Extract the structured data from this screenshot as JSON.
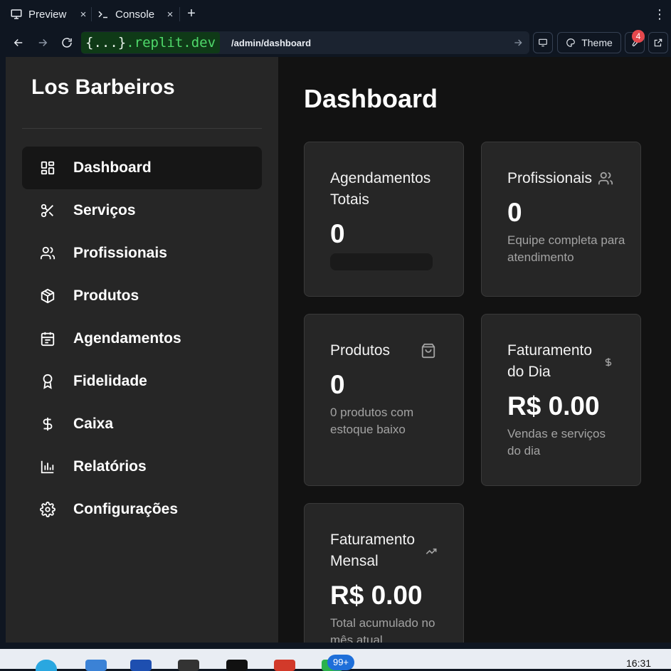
{
  "browser": {
    "tabs": [
      {
        "label": "Preview",
        "icon": "monitor-icon",
        "active": true
      },
      {
        "label": "Console",
        "icon": "terminal-icon",
        "active": false
      }
    ],
    "url_host_prefix": "{...}",
    "url_host": ".replit.dev",
    "url_path": "/admin/dashboard",
    "theme_label": "Theme",
    "extensions_badge": "4"
  },
  "sidebar": {
    "brand": "Los Barbeiros",
    "items": [
      {
        "label": "Dashboard",
        "icon": "grid-icon",
        "active": true
      },
      {
        "label": "Serviços",
        "icon": "scissors-icon"
      },
      {
        "label": "Profissionais",
        "icon": "users-icon"
      },
      {
        "label": "Produtos",
        "icon": "package-icon"
      },
      {
        "label": "Agendamentos",
        "icon": "calendar-icon"
      },
      {
        "label": "Fidelidade",
        "icon": "award-icon"
      },
      {
        "label": "Caixa",
        "icon": "dollar-icon"
      },
      {
        "label": "Relatórios",
        "icon": "bar-chart-icon"
      },
      {
        "label": "Configurações",
        "icon": "gear-icon"
      }
    ]
  },
  "main": {
    "title": "Dashboard",
    "cards": {
      "agendamentos": {
        "title": "Agendamentos Totais",
        "value": "0"
      },
      "profissionais": {
        "title": "Profissionais",
        "value": "0",
        "subtitle": "Equipe completa para atendimento",
        "icon": "users-icon"
      },
      "produtos": {
        "title": "Produtos",
        "value": "0",
        "subtitle": "0 produtos com estoque baixo",
        "icon": "shopping-bag-icon"
      },
      "faturamento_dia": {
        "title": "Faturamento do Dia",
        "value": "R$ 0.00",
        "subtitle": "Vendas e serviços do dia",
        "icon": "dollar-icon"
      },
      "faturamento_mensal": {
        "title": "Faturamento Mensal",
        "value": "R$ 0.00",
        "subtitle": "Total acumulado no mês atual",
        "icon": "trending-up-icon"
      }
    }
  },
  "taskbar": {
    "time": "16:31",
    "notification_badge": "99+"
  },
  "colors": {
    "sidebar_bg": "#262626",
    "main_bg": "#121212",
    "card_bg": "#262626",
    "url_host": "#4fd86a",
    "badge": "#e5484d"
  }
}
